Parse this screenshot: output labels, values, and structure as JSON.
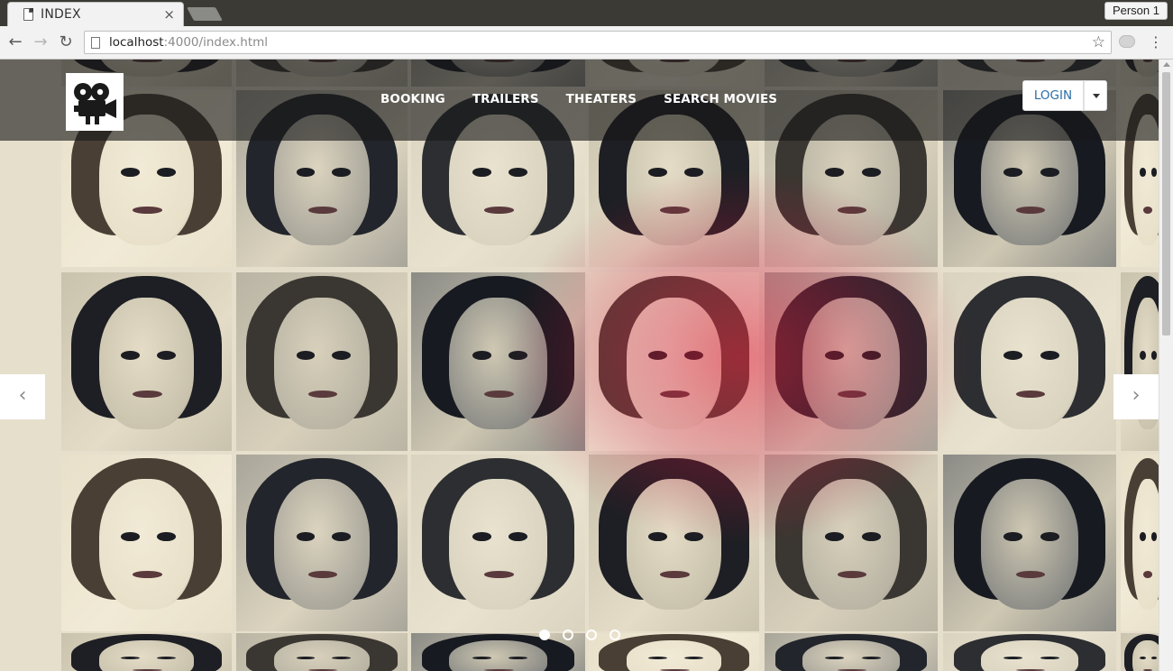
{
  "browser": {
    "tab_title": "INDEX",
    "tab_close": "×",
    "profile_label": "Person 1",
    "url_host": "localhost",
    "url_rest": ":4000/index.html",
    "back_glyph": "←",
    "forward_glyph": "→",
    "reload_glyph": "↻",
    "star_glyph": "☆",
    "menu_glyph": "⋮"
  },
  "site": {
    "logo_icon": "movie-camera-icon",
    "nav": [
      {
        "label": "BOOKING"
      },
      {
        "label": "TRAILERS"
      },
      {
        "label": "THEATERS"
      },
      {
        "label": "SEARCH MOVIES"
      }
    ],
    "login_label": "LOGIN",
    "carousel": {
      "prev_glyph": "‹",
      "next_glyph": "›",
      "slide_count": 4,
      "active_slide": 1
    }
  },
  "colors": {
    "header_overlay": "#191919",
    "link_blue": "#2a6ea6",
    "accent_red": "#dc1e3c"
  }
}
